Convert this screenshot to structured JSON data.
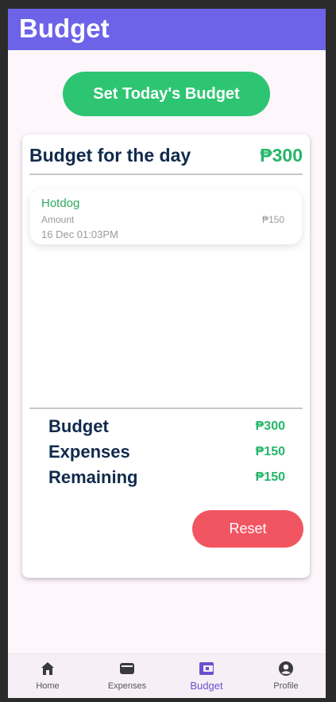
{
  "app": {
    "title": "Budget"
  },
  "actions": {
    "set_budget_label": "Set Today's Budget",
    "reset_label": "Reset"
  },
  "budget_card": {
    "title": "Budget for the day",
    "amount": "₱300",
    "expenses": [
      {
        "name": "Hotdog",
        "amount_label": "Amount",
        "amount": "₱150",
        "date": "16 Dec 01:03PM"
      }
    ]
  },
  "summary": [
    {
      "label": "Budget",
      "value": "₱300"
    },
    {
      "label": "Expenses",
      "value": "₱150"
    },
    {
      "label": "Remaining",
      "value": "₱150"
    }
  ],
  "nav": {
    "active": "Budget",
    "items": [
      {
        "label": "Home",
        "icon": "home-icon"
      },
      {
        "label": "Expenses",
        "icon": "wallet-icon"
      },
      {
        "label": "Budget",
        "icon": "budget-wallet-icon"
      },
      {
        "label": "Profile",
        "icon": "profile-icon"
      }
    ]
  },
  "colors": {
    "appbar": "#6c63e9",
    "primary_green": "#2ec572",
    "reset_red": "#f25562",
    "heading_navy": "#102a4c",
    "active_nav": "#6c4fd0"
  }
}
